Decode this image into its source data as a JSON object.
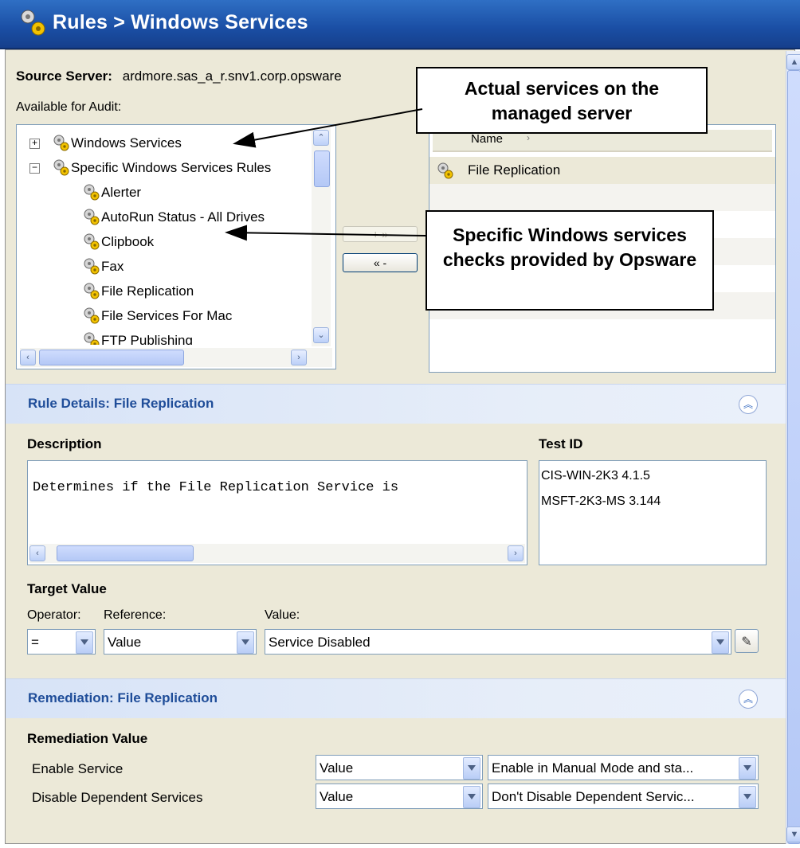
{
  "window": {
    "title": "Rules > Windows Services"
  },
  "source": {
    "label": "Source Server:",
    "value": "ardmore.sas_a_r.snv1.corp.opsware"
  },
  "available": {
    "label": "Available for Audit:",
    "tree": [
      {
        "label": "Windows Services",
        "expander": "+"
      },
      {
        "label": "Specific Windows Services Rules",
        "expander": "−"
      },
      {
        "label": "Alerter"
      },
      {
        "label": "AutoRun Status - All Drives"
      },
      {
        "label": "Clipbook"
      },
      {
        "label": "Fax"
      },
      {
        "label": "File Replication"
      },
      {
        "label": "File Services For Mac"
      },
      {
        "label": "FTP Publishing"
      }
    ]
  },
  "transfer": {
    "add_label": "+ »",
    "remove_label": "« -"
  },
  "selected": {
    "column_header": "Name",
    "rows": [
      "File Replication"
    ]
  },
  "callouts": {
    "actual": "Actual services on the managed server",
    "specific": "Specific Windows services checks provided by Opsware"
  },
  "rule_details": {
    "header": "Rule Details: File Replication",
    "description_label": "Description",
    "description_text": "Determines if the File Replication Service is",
    "test_id_label": "Test ID",
    "test_ids": [
      "CIS-WIN-2K3 4.1.5",
      "MSFT-2K3-MS 3.144"
    ],
    "target_value_label": "Target Value",
    "operator_label": "Operator:",
    "reference_label": "Reference:",
    "value_label": "Value:",
    "operator_value": "=",
    "reference_value": "Value",
    "value_value": "Service Disabled"
  },
  "remediation": {
    "header": "Remediation: File Replication",
    "value_label": "Remediation Value",
    "rows": [
      {
        "label": "Enable Service",
        "reference": "Value",
        "value": "Enable in Manual Mode and sta..."
      },
      {
        "label": "Disable Dependent Services",
        "reference": "Value",
        "value": "Don't Disable Dependent Servic..."
      }
    ]
  },
  "colors": {
    "title_bar": "#1a4ea4",
    "section_header_text": "#1f4d99",
    "selected_row": "#ece9d8"
  }
}
